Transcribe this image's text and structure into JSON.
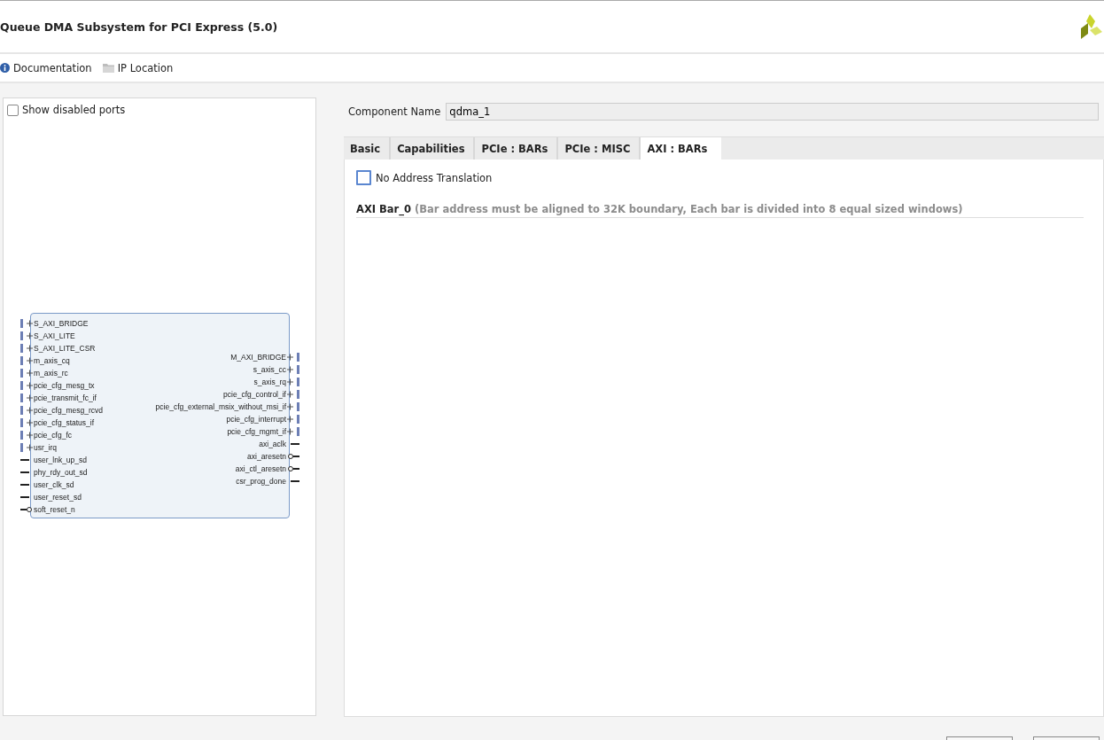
{
  "window": {
    "title": "Queue DMA Subsystem for PCI Express (5.0)"
  },
  "toolbar": [
    {
      "label": "Documentation",
      "kind": "info"
    },
    {
      "label": "IP Location",
      "kind": "folder"
    }
  ],
  "symbol_panel": {
    "show_disabled_ports": {
      "label": "Show disabled ports",
      "checked": false
    },
    "left_ports": [
      {
        "name": "S_AXI_BRIDGE",
        "kind": "bus"
      },
      {
        "name": "S_AXI_LITE",
        "kind": "bus"
      },
      {
        "name": "S_AXI_LITE_CSR",
        "kind": "bus"
      },
      {
        "name": "m_axis_cq",
        "kind": "bus"
      },
      {
        "name": "m_axis_rc",
        "kind": "bus"
      },
      {
        "name": "pcie_cfg_mesg_tx",
        "kind": "bus"
      },
      {
        "name": "pcie_transmit_fc_if",
        "kind": "bus"
      },
      {
        "name": "pcie_cfg_mesg_rcvd",
        "kind": "bus"
      },
      {
        "name": "pcie_cfg_status_if",
        "kind": "bus"
      },
      {
        "name": "pcie_cfg_fc",
        "kind": "bus"
      },
      {
        "name": "usr_irq",
        "kind": "bus"
      },
      {
        "name": "user_lnk_up_sd",
        "kind": "wire"
      },
      {
        "name": "phy_rdy_out_sd",
        "kind": "wire"
      },
      {
        "name": "user_clk_sd",
        "kind": "wire"
      },
      {
        "name": "user_reset_sd",
        "kind": "wire"
      },
      {
        "name": "soft_reset_n",
        "kind": "inverted"
      }
    ],
    "right_ports": [
      {
        "name": "M_AXI_BRIDGE",
        "kind": "bus"
      },
      {
        "name": "s_axis_cc",
        "kind": "bus"
      },
      {
        "name": "s_axis_rq",
        "kind": "bus"
      },
      {
        "name": "pcie_cfg_control_if",
        "kind": "bus"
      },
      {
        "name": "pcie_cfg_external_msix_without_msi_if",
        "kind": "bus"
      },
      {
        "name": "pcie_cfg_interrupt",
        "kind": "bus"
      },
      {
        "name": "pcie_cfg_mgmt_if",
        "kind": "bus"
      },
      {
        "name": "axi_aclk",
        "kind": "wire"
      },
      {
        "name": "axi_aresetn",
        "kind": "inverted"
      },
      {
        "name": "axi_ctl_aresetn",
        "kind": "inverted"
      },
      {
        "name": "csr_prog_done",
        "kind": "wire"
      }
    ]
  },
  "component_name": {
    "label": "Component Name",
    "value": "qdma_1"
  },
  "tabs": [
    {
      "label": "Basic",
      "selected": false
    },
    {
      "label": "Capabilities",
      "selected": false
    },
    {
      "label": "PCIe : BARs",
      "selected": false
    },
    {
      "label": "PCIe : MISC",
      "selected": false
    },
    {
      "label": "AXI : BARs",
      "selected": true
    }
  ],
  "axi_bars": {
    "no_address_translation": {
      "label": "No Address Translation",
      "checked": false
    },
    "section": {
      "title": "AXI Bar_0",
      "note": "(Bar address must be aligned to 32K boundary, Each bar is divided into 8 equal sized windows)"
    }
  },
  "footer_buttons": [
    {
      "kind": "button"
    },
    {
      "kind": "button"
    }
  ]
}
